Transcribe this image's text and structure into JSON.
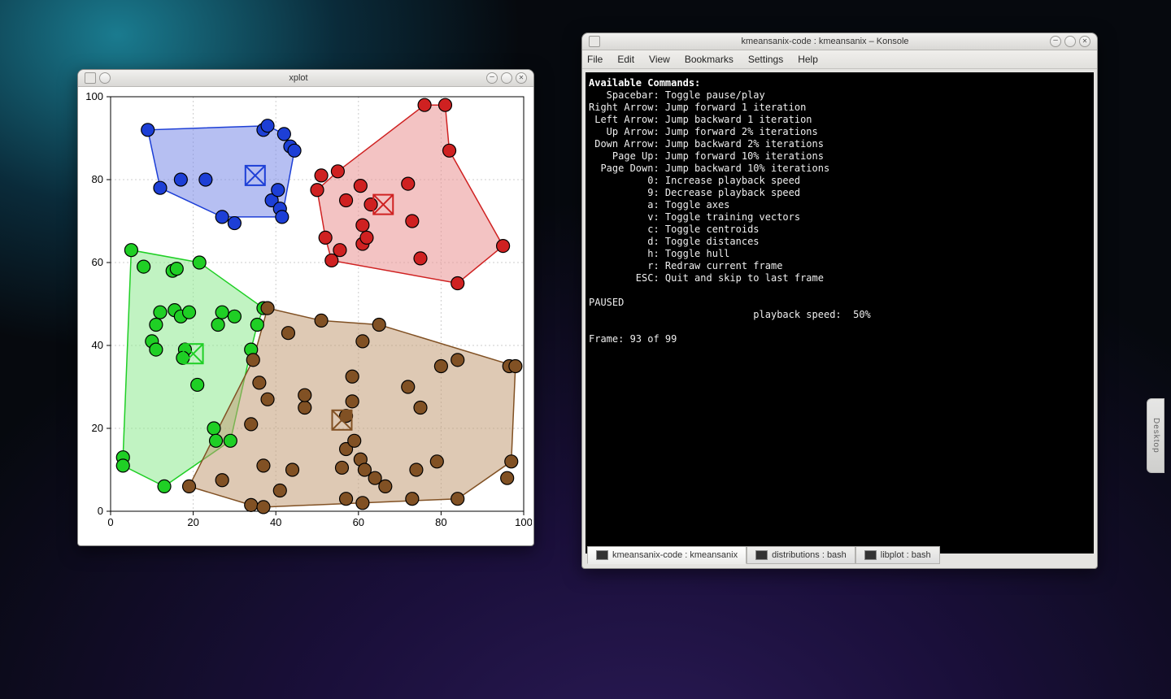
{
  "xplot": {
    "title": "xplot"
  },
  "konsole": {
    "title": "kmeansanix-code : kmeansanix – Konsole",
    "menu": {
      "file": "File",
      "edit": "Edit",
      "view": "View",
      "bookmarks": "Bookmarks",
      "settings": "Settings",
      "help": "Help"
    },
    "terminal": {
      "header": "Available Commands:",
      "status": "PAUSED",
      "speed_line": "                            playback speed:  50%",
      "frame_line": "Frame: 93 of 99",
      "commands": [
        {
          "key": "Spacebar",
          "desc": "Toggle pause/play"
        },
        {
          "key": "Right Arrow",
          "desc": "Jump forward 1 iteration"
        },
        {
          "key": "Left Arrow",
          "desc": "Jump backward 1 iteration"
        },
        {
          "key": "Up Arrow",
          "desc": "Jump forward 2% iterations"
        },
        {
          "key": "Down Arrow",
          "desc": "Jump backward 2% iterations"
        },
        {
          "key": "Page Up",
          "desc": "Jump forward 10% iterations"
        },
        {
          "key": "Page Down",
          "desc": "Jump backward 10% iterations"
        },
        {
          "key": "0",
          "desc": "Increase playback speed"
        },
        {
          "key": "9",
          "desc": "Decrease playback speed"
        },
        {
          "key": "a",
          "desc": "Toggle axes"
        },
        {
          "key": "v",
          "desc": "Toggle training vectors"
        },
        {
          "key": "c",
          "desc": "Toggle centroids"
        },
        {
          "key": "d",
          "desc": "Toggle distances"
        },
        {
          "key": "h",
          "desc": "Toggle hull"
        },
        {
          "key": "r",
          "desc": "Redraw current frame"
        },
        {
          "key": "ESC",
          "desc": "Quit and skip to last frame"
        }
      ]
    },
    "tabs": [
      {
        "label": "kmeansanix-code : kmeansanix",
        "active": true
      },
      {
        "label": "distributions : bash",
        "active": false
      },
      {
        "label": "libplot : bash",
        "active": false
      }
    ]
  },
  "desktop_tab": "Desktop",
  "chart_data": {
    "type": "scatter",
    "title": "",
    "xlabel": "",
    "ylabel": "",
    "xlim": [
      0,
      100
    ],
    "ylim": [
      0,
      100
    ],
    "xticks": [
      0,
      20,
      40,
      60,
      80,
      100
    ],
    "yticks": [
      0,
      20,
      40,
      60,
      80,
      100
    ],
    "series": [
      {
        "name": "blue",
        "color": "#1d3fd6",
        "fill": "#7a8be8",
        "centroid": [
          35,
          81
        ],
        "points": [
          [
            9,
            92
          ],
          [
            12,
            78
          ],
          [
            17,
            80
          ],
          [
            23,
            80
          ],
          [
            27,
            71
          ],
          [
            30,
            69.5
          ],
          [
            37,
            92
          ],
          [
            38,
            93
          ],
          [
            39,
            75
          ],
          [
            40.5,
            77.5
          ],
          [
            41,
            73
          ],
          [
            41.5,
            71
          ],
          [
            42,
            91
          ],
          [
            43.5,
            88
          ],
          [
            44.5,
            87
          ]
        ],
        "hull": [
          [
            9,
            92
          ],
          [
            12,
            78
          ],
          [
            27,
            71
          ],
          [
            41.5,
            71
          ],
          [
            44.5,
            87
          ],
          [
            42,
            91
          ],
          [
            38,
            93
          ]
        ]
      },
      {
        "name": "red",
        "color": "#cf2121",
        "fill": "#e99292",
        "centroid": [
          66,
          74
        ],
        "points": [
          [
            50,
            77.5
          ],
          [
            51,
            81
          ],
          [
            52,
            66
          ],
          [
            53.5,
            60.5
          ],
          [
            55.5,
            63
          ],
          [
            55,
            82
          ],
          [
            57,
            75
          ],
          [
            61,
            64.5
          ],
          [
            61,
            69
          ],
          [
            62,
            66
          ],
          [
            60.5,
            78.5
          ],
          [
            63,
            74
          ],
          [
            72,
            79
          ],
          [
            73,
            70
          ],
          [
            75,
            61
          ],
          [
            76,
            98
          ],
          [
            81,
            98
          ],
          [
            82,
            87
          ],
          [
            84,
            55
          ],
          [
            95,
            64
          ]
        ],
        "hull": [
          [
            50,
            77.5
          ],
          [
            52,
            66
          ],
          [
            53.5,
            60.5
          ],
          [
            84,
            55
          ],
          [
            95,
            64
          ],
          [
            82,
            87
          ],
          [
            81,
            98
          ],
          [
            76,
            98
          ],
          [
            55,
            82
          ]
        ]
      },
      {
        "name": "green",
        "color": "#1fcf25",
        "fill": "#8ee990",
        "centroid": [
          20,
          38
        ],
        "points": [
          [
            3,
            13
          ],
          [
            3,
            11
          ],
          [
            5,
            63
          ],
          [
            8,
            59
          ],
          [
            10,
            41
          ],
          [
            11,
            45
          ],
          [
            11,
            39
          ],
          [
            12,
            48
          ],
          [
            13,
            6
          ],
          [
            15,
            58
          ],
          [
            16,
            58.5
          ],
          [
            15.5,
            48.5
          ],
          [
            17,
            47
          ],
          [
            18,
            39
          ],
          [
            17.5,
            37
          ],
          [
            19,
            48
          ],
          [
            21.5,
            60
          ],
          [
            21,
            30.5
          ],
          [
            25,
            20
          ],
          [
            25.5,
            17
          ],
          [
            26,
            45
          ],
          [
            27,
            48
          ],
          [
            29,
            17
          ],
          [
            30,
            47
          ],
          [
            34,
            39
          ],
          [
            35.5,
            45
          ],
          [
            37,
            49
          ]
        ],
        "hull": [
          [
            3,
            11
          ],
          [
            3,
            13
          ],
          [
            5,
            63
          ],
          [
            21.5,
            60
          ],
          [
            37,
            49
          ],
          [
            35.5,
            45
          ],
          [
            34,
            39
          ],
          [
            29,
            17
          ],
          [
            13,
            6
          ]
        ]
      },
      {
        "name": "brown",
        "color": "#815124",
        "fill": "#c39d77",
        "centroid": [
          56,
          22
        ],
        "points": [
          [
            19,
            6
          ],
          [
            27,
            7.5
          ],
          [
            34,
            1.5
          ],
          [
            34,
            21
          ],
          [
            34.5,
            36.5
          ],
          [
            36,
            31
          ],
          [
            37,
            1
          ],
          [
            37,
            11
          ],
          [
            38,
            27
          ],
          [
            38,
            49
          ],
          [
            41,
            5
          ],
          [
            43,
            43
          ],
          [
            44,
            10
          ],
          [
            47,
            25
          ],
          [
            47,
            28
          ],
          [
            51,
            46
          ],
          [
            56,
            10.5
          ],
          [
            57,
            15
          ],
          [
            57,
            23
          ],
          [
            57,
            3
          ],
          [
            58.5,
            26.5
          ],
          [
            58.5,
            32.5
          ],
          [
            59,
            17
          ],
          [
            61,
            41
          ],
          [
            60.5,
            12.5
          ],
          [
            61.5,
            10
          ],
          [
            61,
            2
          ],
          [
            64,
            8
          ],
          [
            65,
            45
          ],
          [
            66.5,
            6
          ],
          [
            72,
            30
          ],
          [
            73,
            3
          ],
          [
            74,
            10
          ],
          [
            75,
            25
          ],
          [
            79,
            12
          ],
          [
            80,
            35
          ],
          [
            84,
            3
          ],
          [
            84,
            36.5
          ],
          [
            96,
            8
          ],
          [
            96.5,
            35
          ],
          [
            98,
            35
          ],
          [
            97,
            12
          ]
        ],
        "hull": [
          [
            19,
            6
          ],
          [
            34,
            1.5
          ],
          [
            37,
            1
          ],
          [
            84,
            3
          ],
          [
            97,
            12
          ],
          [
            98,
            35
          ],
          [
            65,
            45
          ],
          [
            51,
            46
          ],
          [
            38,
            49
          ],
          [
            34.5,
            36.5
          ]
        ]
      }
    ]
  }
}
